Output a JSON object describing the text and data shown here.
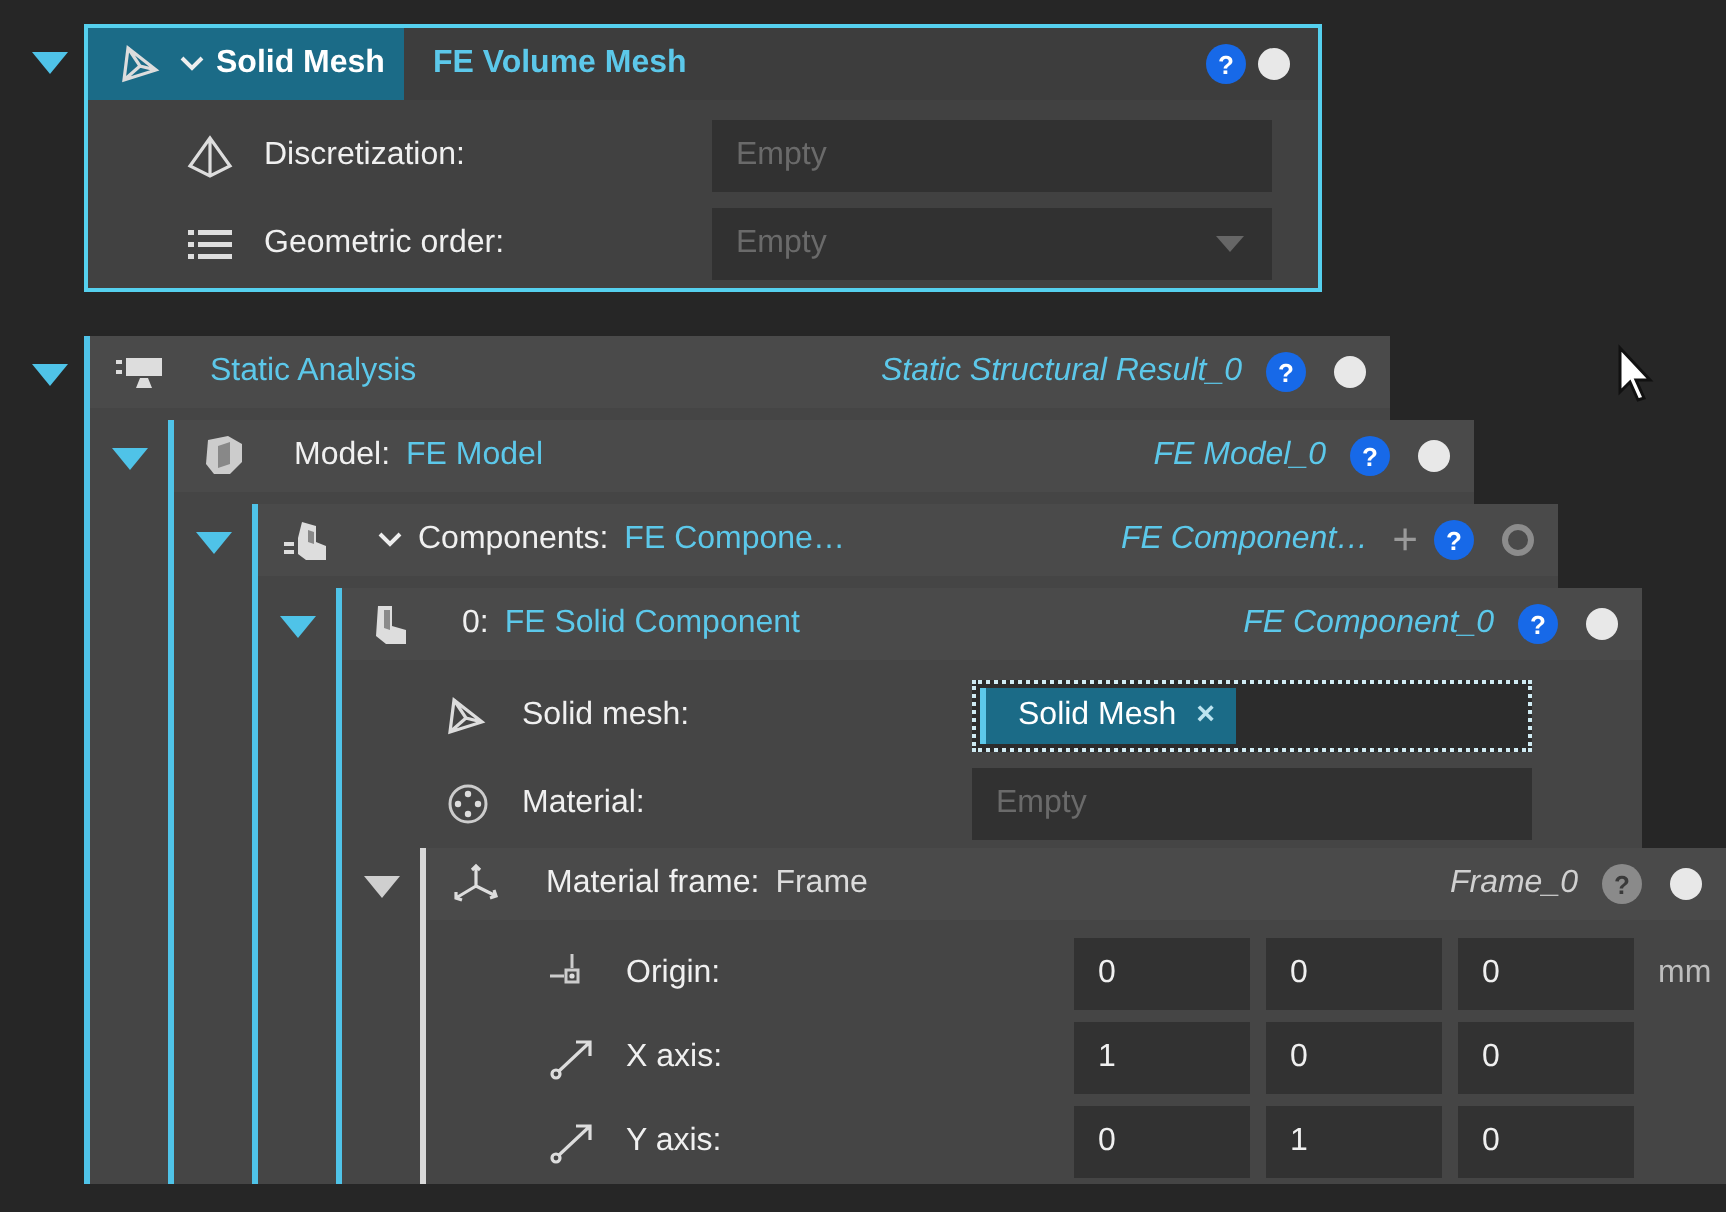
{
  "top_card": {
    "title": "Solid Mesh",
    "type": "FE Volume Mesh",
    "help": "?",
    "status_filled": true,
    "expanded": true,
    "selected": true,
    "has_menu": true,
    "rows": [
      {
        "label": "Discretization:",
        "kind": "text",
        "placeholder": "Empty"
      },
      {
        "label": "Geometric order:",
        "kind": "dropdown",
        "placeholder": "Empty"
      }
    ]
  },
  "tree": {
    "title": "Static Analysis",
    "instance": "Static Structural Result_0",
    "help": "?",
    "status_filled": true,
    "expanded": true,
    "active": true,
    "children": [
      {
        "label": "Model:",
        "title": "FE Model",
        "instance": "FE Model_0",
        "help": "?",
        "status_filled": true,
        "expanded": true,
        "active": true,
        "children": [
          {
            "label": "Components:",
            "title": "FE Compone…",
            "instance": "FE Component…",
            "add": "+",
            "help": "?",
            "status_filled": false,
            "expanded": true,
            "active": true,
            "has_menu": true,
            "children": [
              {
                "label": "0:",
                "title": "FE Solid Component",
                "instance": "FE Component_0",
                "help": "?",
                "status_filled": true,
                "expanded": true,
                "active": true,
                "rows": [
                  {
                    "label": "Solid mesh:",
                    "kind": "reference",
                    "chip": "Solid Mesh",
                    "remove": "×",
                    "focused": true
                  },
                  {
                    "label": "Material:",
                    "kind": "text",
                    "placeholder": "Empty"
                  }
                ],
                "children": [
                  {
                    "label": "Material frame:",
                    "title": "Frame",
                    "instance": "Frame_0",
                    "help": "?",
                    "status_filled": true,
                    "expanded": true,
                    "active": false,
                    "rows": [
                      {
                        "label": "Origin:",
                        "kind": "vector",
                        "values": [
                          "0",
                          "0",
                          "0"
                        ],
                        "unit": "mm"
                      },
                      {
                        "label": "X axis:",
                        "kind": "vector",
                        "values": [
                          "1",
                          "0",
                          "0"
                        ]
                      },
                      {
                        "label": "Y axis:",
                        "kind": "vector",
                        "values": [
                          "0",
                          "1",
                          "0"
                        ]
                      }
                    ]
                  }
                ]
              }
            ]
          }
        ]
      }
    ]
  }
}
